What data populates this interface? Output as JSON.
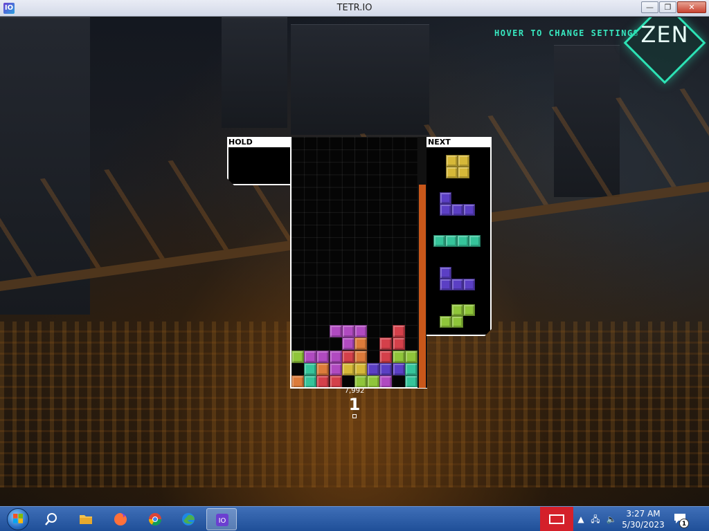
{
  "window": {
    "title": "TETR.IO",
    "app_icon_glyph": "IO",
    "minimize": "—",
    "maximize": "❐",
    "close": "✕"
  },
  "game": {
    "settings_hint": "HOVER TO CHANGE SETTINGS",
    "mode": "ZEN",
    "hold_label": "HOLD",
    "next_label": "NEXT",
    "score": "7,992",
    "lines": "1",
    "garbage_meter_fill": 0.81,
    "next_queue": [
      "O",
      "J",
      "I",
      "J",
      "S"
    ],
    "colors": {
      "O": "#d6b838",
      "J": "#5b3fc4",
      "I": "#35c49a",
      "S": "#8fc53a",
      "Z": "#d4404a",
      "L": "#dc7b3a",
      "T": "#b04ac0",
      "accent": "#2de2b5",
      "meter": "#c8571a"
    }
  },
  "taskbar": {
    "items": [
      {
        "name": "search-icon",
        "icon": "search"
      },
      {
        "name": "file-explorer-icon",
        "icon": "folder"
      },
      {
        "name": "firefox-icon",
        "icon": "firefox"
      },
      {
        "name": "chrome-icon",
        "icon": "chrome"
      },
      {
        "name": "edge-icon",
        "icon": "edge"
      },
      {
        "name": "tetrio-taskbar-icon",
        "icon": "tetrio",
        "active": true
      }
    ],
    "time": "3:27 AM",
    "date": "5/30/2023",
    "notification_count": "1"
  }
}
